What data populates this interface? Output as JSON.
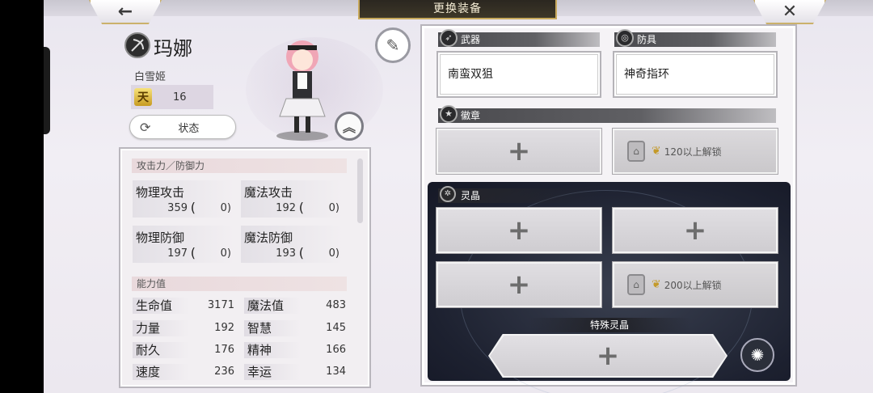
{
  "header": {
    "title": "更换装备",
    "back_icon": "←",
    "close_icon": "✕"
  },
  "character": {
    "name": "玛娜",
    "title": "白雪姬",
    "rank_icon": "天",
    "rank": "16",
    "status_label": "状态",
    "status_icon": "⟳"
  },
  "stats": {
    "attack_defense_header": "攻击力／防御力",
    "physical_attack": {
      "label": "物理攻击",
      "base": "359",
      "bonus": "0"
    },
    "magic_attack": {
      "label": "魔法攻击",
      "base": "192",
      "bonus": "0"
    },
    "physical_defense": {
      "label": "物理防御",
      "base": "197",
      "bonus": "0"
    },
    "magic_defense": {
      "label": "魔法防御",
      "base": "193",
      "bonus": "0"
    },
    "ability_header": "能力值",
    "abilities": [
      {
        "label": "生命值",
        "value": "3171"
      },
      {
        "label": "魔法值",
        "value": "483"
      },
      {
        "label": "力量",
        "value": "192"
      },
      {
        "label": "智慧",
        "value": "145"
      },
      {
        "label": "耐久",
        "value": "176"
      },
      {
        "label": "精神",
        "value": "166"
      },
      {
        "label": "速度",
        "value": "236"
      },
      {
        "label": "幸运",
        "value": "134"
      }
    ]
  },
  "equipment": {
    "weapon_header": "武器",
    "weapon_name": "南蛮双狙",
    "armor_header": "防具",
    "armor_name": "神奇指环",
    "badge_header": "徽章",
    "badge_locked_text": "120以上解锁",
    "crystal_header": "灵晶",
    "crystal_locked_text": "200以上解锁",
    "special_crystal_label": "特殊灵晶",
    "plus_symbol": "+"
  }
}
